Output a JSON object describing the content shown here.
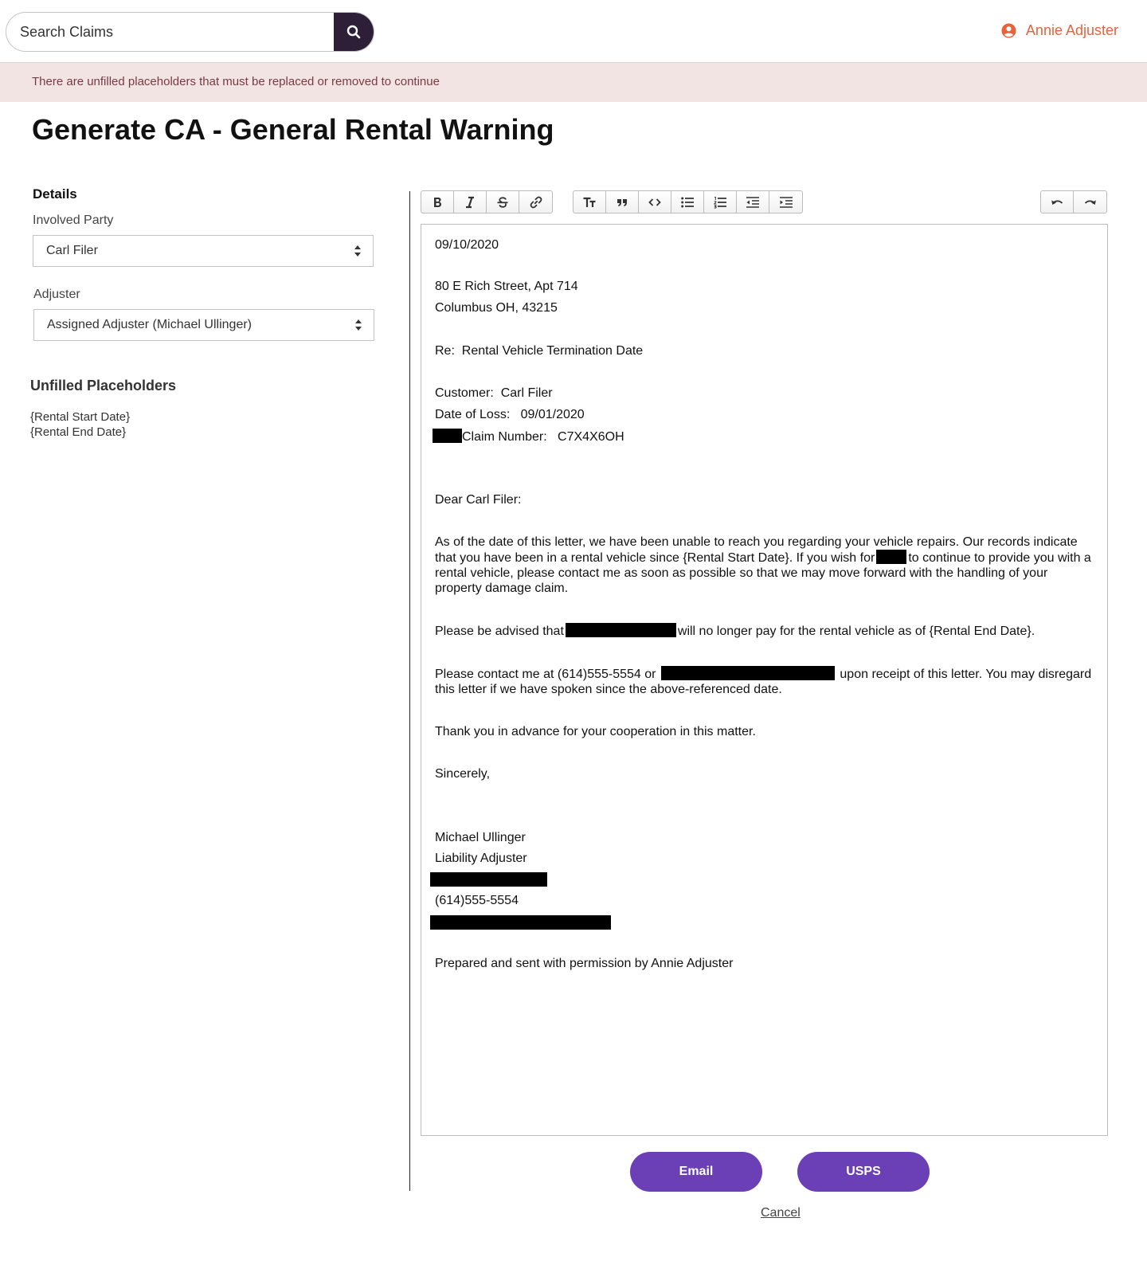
{
  "header": {
    "search_placeholder": "Search Claims",
    "user_name": "Annie Adjuster",
    "accent_color": "#e8623a"
  },
  "banner": {
    "message": "There are unfilled placeholders that must be replaced or removed to continue"
  },
  "page_title": "Generate CA - General Rental Warning",
  "details": {
    "title": "Details",
    "involved_party_label": "Involved Party",
    "involved_party_value": "Carl Filer",
    "adjuster_label": "Adjuster",
    "adjuster_value": "Assigned Adjuster (Michael Ullinger)"
  },
  "unfilled": {
    "title": "Unfilled Placeholders",
    "items": [
      "{Rental Start Date}",
      "{Rental End Date}"
    ]
  },
  "toolbar": {
    "group1": [
      "bold-icon",
      "italic-icon",
      "strikethrough-icon",
      "link-icon"
    ],
    "group2": [
      "heading-icon",
      "quote-icon",
      "code-icon",
      "bullet-list-icon",
      "numbered-list-icon",
      "outdent-icon",
      "indent-icon"
    ],
    "group3": [
      "undo-icon",
      "redo-icon"
    ]
  },
  "letter": {
    "date": "09/10/2020",
    "address_line1": "80 E Rich Street, Apt 714",
    "address_line2": "Columbus OH, 43215",
    "re_label": "Re:",
    "re_value": "Rental Vehicle Termination Date",
    "customer_label": "Customer:",
    "customer_value": "Carl Filer",
    "dol_label": "Date of Loss:",
    "dol_value": "09/01/2020",
    "claim_label": "Claim Number:",
    "claim_value": "C7X4X6OH",
    "salutation": "Dear Carl Filer:",
    "para1_a": "As of the date of this letter, we have been unable to reach you regarding your vehicle repairs.  Our records indicate that you have been in a rental vehicle since {Rental Start Date}.  If you wish for",
    "para1_b": "to continue to provide you with a rental vehicle, please contact me as soon as possible so that we may move forward with the handling of your property damage claim.",
    "para2_a": "Please be advised that",
    "para2_b": "will no longer pay for the rental vehicle as of {Rental End Date}.",
    "para3_a": "Please contact me at (614)555-5554 or",
    "para3_b": "upon receipt of this letter. You may disregard this letter if we have spoken since the above-referenced date.",
    "thanks": "Thank you in advance for your cooperation in this matter.",
    "closing": "Sincerely,",
    "signer_name": "Michael Ullinger",
    "signer_title": "Liability Adjuster",
    "signer_phone": "(614)555-5554",
    "prepared_by": "Prepared and sent with permission by Annie Adjuster"
  },
  "actions": {
    "email_label": "Email",
    "usps_label": "USPS",
    "cancel_label": "Cancel",
    "button_color": "#6b3fb5"
  }
}
